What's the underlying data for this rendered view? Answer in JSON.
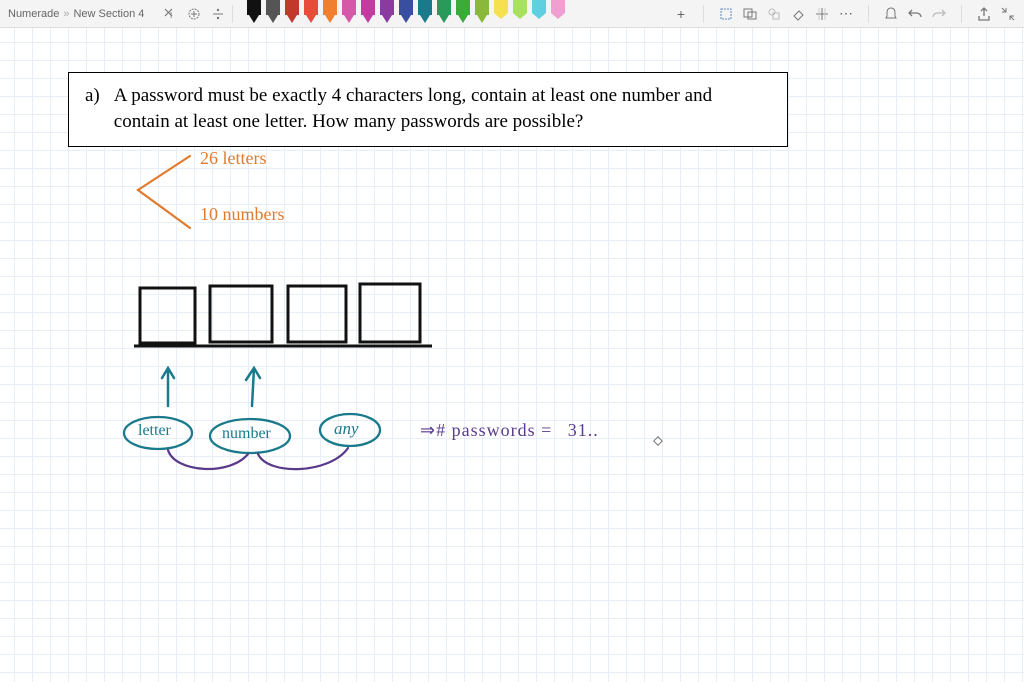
{
  "breadcrumb": {
    "root": "Numerade",
    "section": "New Section 4"
  },
  "pens": [
    {
      "color": "#111"
    },
    {
      "color": "#555"
    },
    {
      "color": "#c0392b"
    },
    {
      "color": "#e74c3c"
    },
    {
      "color": "#f08030"
    },
    {
      "color": "#d658a8"
    },
    {
      "color": "#c33aa0"
    },
    {
      "color": "#8b3aa0"
    },
    {
      "color": "#3a4ea0"
    },
    {
      "color": "#1a7a8c"
    },
    {
      "color": "#2a9a5a"
    },
    {
      "color": "#3aaa3a"
    },
    {
      "color": "#8ab83a"
    }
  ],
  "highlighters": [
    {
      "color": "#f5e050"
    },
    {
      "color": "#a8e060"
    },
    {
      "color": "#60d0e0"
    },
    {
      "color": "#f0a0d0"
    }
  ],
  "question": {
    "label": "a)",
    "text_line1": "A password must be exactly 4 characters long, contain at least one number and",
    "text_line2": "contain at least one letter. How many passwords are possible?"
  },
  "annotations": {
    "letters": "26 letters",
    "numbers": "10 numbers",
    "letter_label": "letter",
    "number_label": "number",
    "any_label": "any",
    "result_prefix": "⇒# passwords =",
    "result_value": "31.."
  }
}
